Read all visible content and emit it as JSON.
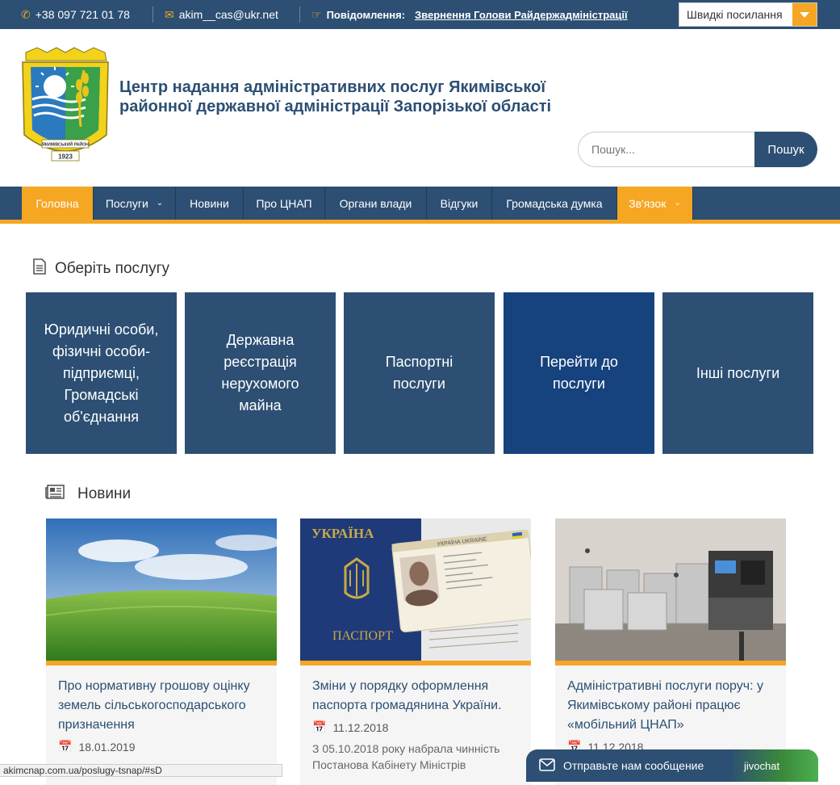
{
  "topbar": {
    "phone": "+38 097 721 01 78",
    "email": "akim__cas@ukr.net",
    "notice_label": "Повідомлення:",
    "notice_link": "Звернення Голови Райдержадміністрації",
    "quick_links": "Швидкі посилання"
  },
  "header": {
    "title_line1": "Центр надання адміністративних послуг Якимівської",
    "title_line2": "районної державної адміністрації Запорізької області",
    "logo_text": "ЯКИМІВСЬКИЙ РАЙОН",
    "logo_year": "1923"
  },
  "search": {
    "placeholder": "Пошук...",
    "button": "Пошук"
  },
  "nav": {
    "items": [
      "Головна",
      "Послуги",
      "Новини",
      "Про ЦНАП",
      "Органи влади",
      "Відгуки",
      "Громадська думка",
      "Зв'язок"
    ]
  },
  "services": {
    "heading": "Оберіть послугу",
    "tiles": [
      "Юридичні особи, фізичні особи-підприємці, Громадські об'єднання",
      "Державна реєстрація нерухомого майна",
      "Паспортні послуги",
      "Перейти до послуги",
      "Інші послуги"
    ]
  },
  "news": {
    "heading": "Новини",
    "cards": [
      {
        "title": "Про нормативну грошову оцінку земель сільськогосподарського призначення",
        "date": "18.01.2019",
        "excerpt": ""
      },
      {
        "title": "Зміни у порядку оформлення паспорта громадянина України.",
        "date": "11.12.2018",
        "excerpt": "З 05.10.2018 року набрала чинність Постанова Кабінету Міністрів"
      },
      {
        "title": "Адміністративні послуги поруч: у Якимівському районі працює «мобільний ЦНАП»",
        "date": "11.12.2018",
        "excerpt": ""
      }
    ],
    "passport": {
      "country": "УКРАЇНА",
      "word": "ПАСПОРТ",
      "card_header": "УКРАЇНА UKRAINE"
    }
  },
  "statusbar": {
    "url": "akimcnap.com.ua/poslugy-tsnap/#sD"
  },
  "chat": {
    "label": "Отправьте нам сообщение",
    "brand": "jivochat"
  },
  "colors": {
    "primary": "#2c4f73",
    "accent": "#f5a623"
  }
}
